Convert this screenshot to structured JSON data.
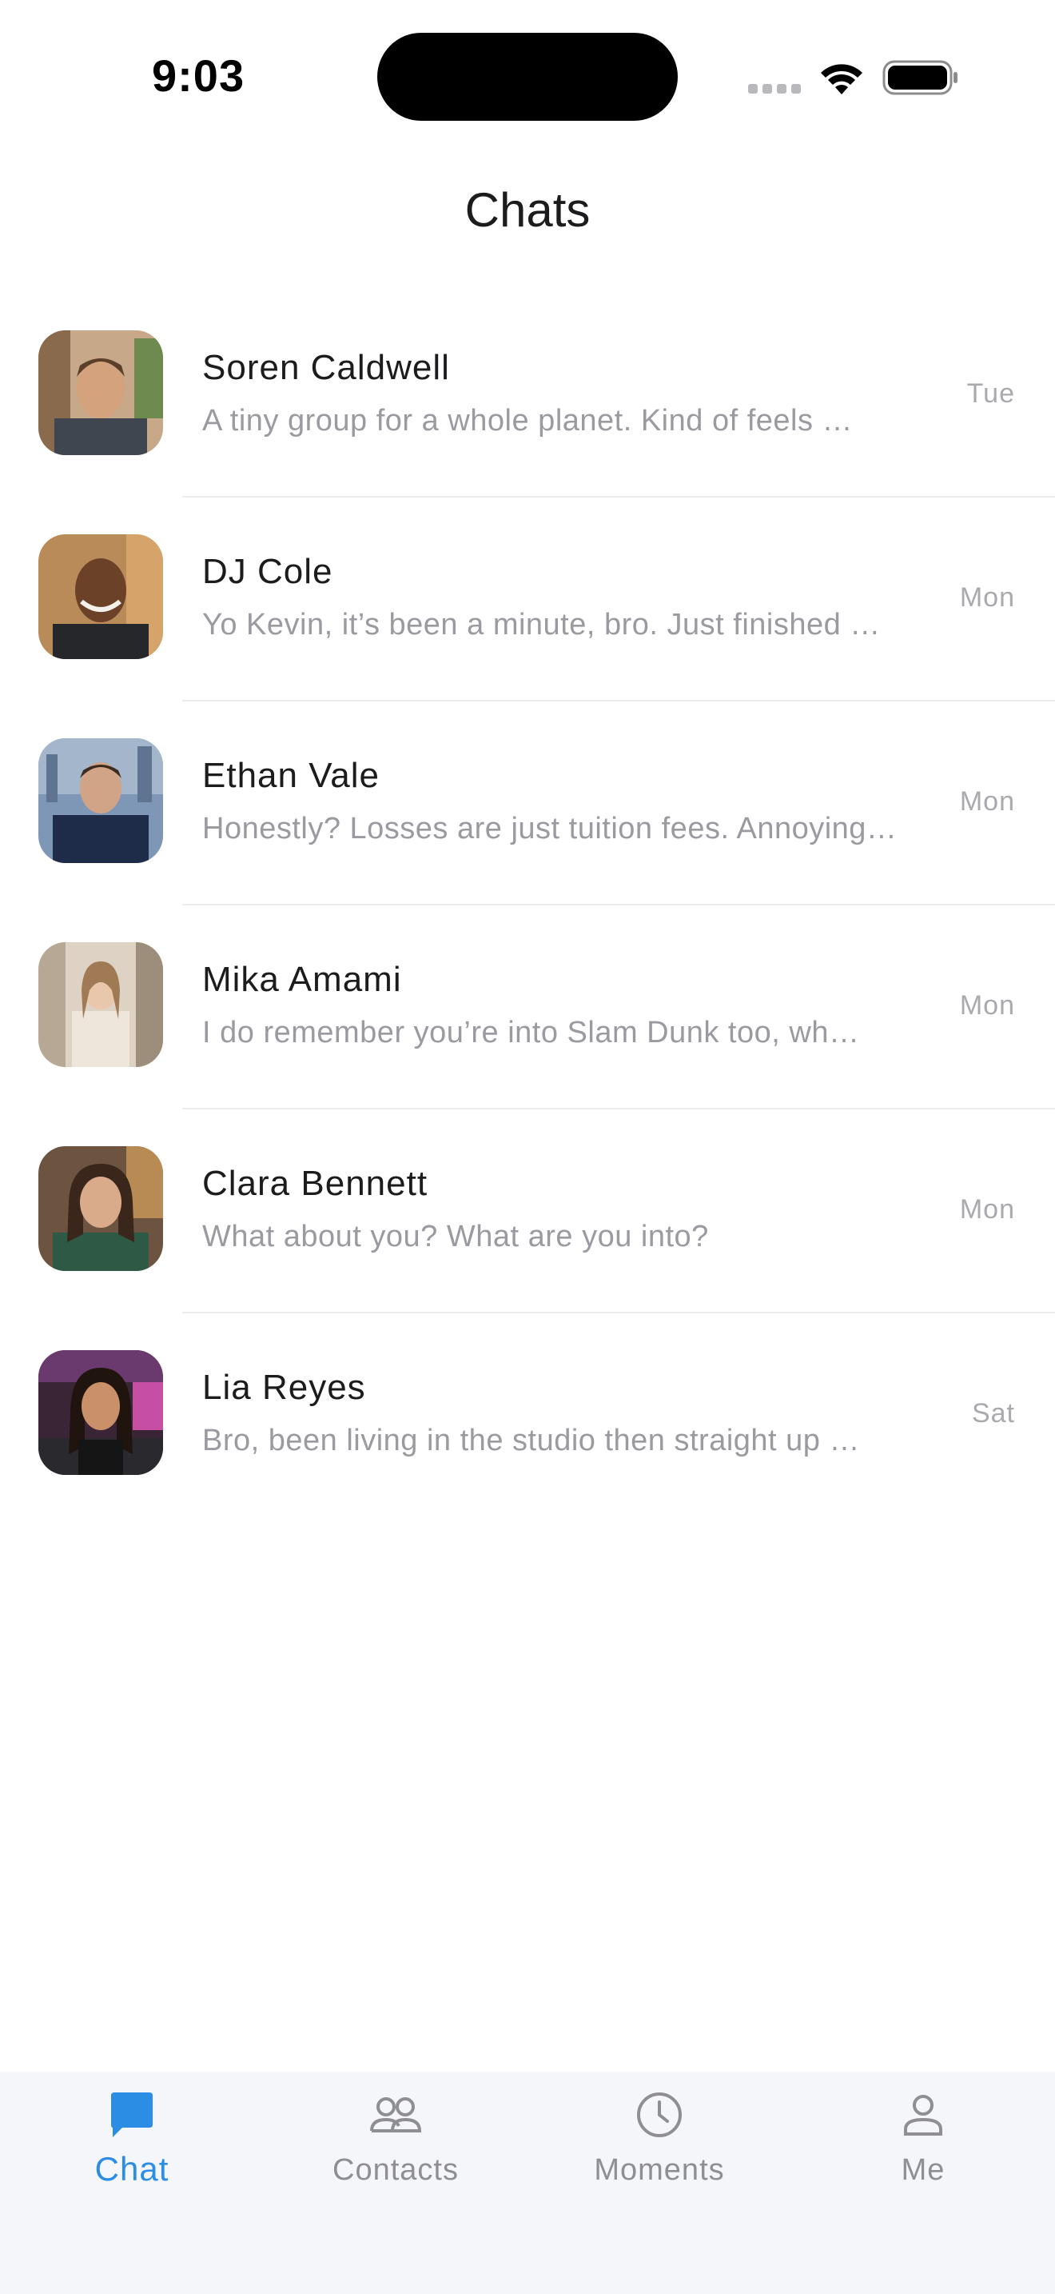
{
  "status_bar": {
    "time": "9:03"
  },
  "header": {
    "title": "Chats"
  },
  "chats": [
    {
      "name": "Soren Caldwell",
      "preview": "A tiny group for a whole planet. Kind of feels …",
      "time": "Tue"
    },
    {
      "name": "DJ Cole",
      "preview": "Yo Kevin, it’s been a minute, bro. Just finished …",
      "time": "Mon"
    },
    {
      "name": "Ethan Vale",
      "preview": "Honestly? Losses are just tuition fees. Annoying…",
      "time": "Mon"
    },
    {
      "name": "Mika Amami",
      "preview": "I do remember you’re into Slam Dunk too, wh…",
      "time": "Mon"
    },
    {
      "name": "Clara Bennett",
      "preview": "What about you? What are you into?",
      "time": "Mon"
    },
    {
      "name": "Lia Reyes",
      "preview": "Bro, been living in the studio then straight up …",
      "time": "Sat"
    }
  ],
  "tabs": [
    {
      "label": "Chat",
      "icon": "chat-bubble-icon",
      "active": true
    },
    {
      "label": "Contacts",
      "icon": "contacts-icon",
      "active": false
    },
    {
      "label": "Moments",
      "icon": "clock-icon",
      "active": false
    },
    {
      "label": "Me",
      "icon": "person-icon",
      "active": false
    }
  ],
  "colors": {
    "accent": "#2b8de4",
    "tab_inactive": "#8e8e93",
    "tab_bar_bg": "#f5f6fa"
  }
}
